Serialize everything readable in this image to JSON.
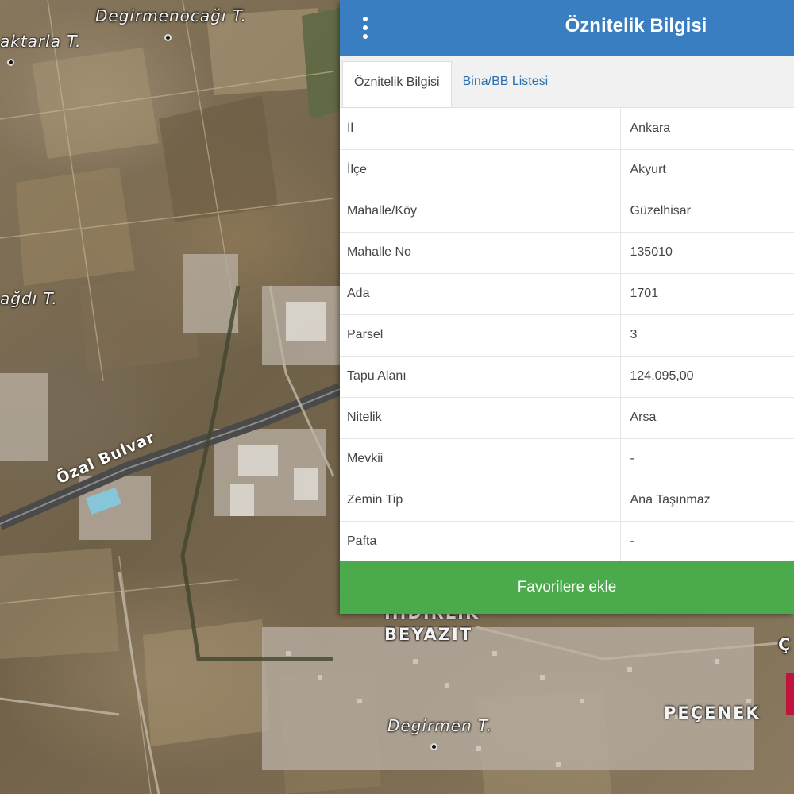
{
  "panel": {
    "title": "Öznitelik Bilgisi",
    "tabs": [
      {
        "label": "Öznitelik Bilgisi",
        "active": true
      },
      {
        "label": "Bina/BB Listesi",
        "active": false
      }
    ],
    "rows": [
      {
        "key": "İl",
        "value": "Ankara"
      },
      {
        "key": "İlçe",
        "value": "Akyurt"
      },
      {
        "key": "Mahalle/Köy",
        "value": "Güzelhisar"
      },
      {
        "key": "Mahalle No",
        "value": "135010"
      },
      {
        "key": "Ada",
        "value": "1701"
      },
      {
        "key": "Parsel",
        "value": "3"
      },
      {
        "key": "Tapu Alanı",
        "value": "124.095,00"
      },
      {
        "key": "Nitelik",
        "value": "Arsa"
      },
      {
        "key": "Mevkii",
        "value": "-"
      },
      {
        "key": "Zemin Tip",
        "value": "Ana Taşınmaz"
      },
      {
        "key": "Pafta",
        "value": "-"
      }
    ],
    "favorite_button": "Favorilere ekle"
  },
  "map": {
    "labels": {
      "degirmenocagi": "Degirmenocağı T.",
      "aktarla": "aktarla T.",
      "ocagi": "ağdı T.",
      "ozal_bulvar": "Özal Bulvar",
      "hidirlik": "HIDIRLIK",
      "beyazit": "BEYAZIT",
      "pecenek": "PEÇENEK",
      "degirmen": "Degirmen T.",
      "edge_c": "Ç"
    },
    "colors": {
      "panel_header": "#3a7ec2",
      "favorite_button": "#4aaa4c",
      "parcel": "#c0143c"
    }
  }
}
